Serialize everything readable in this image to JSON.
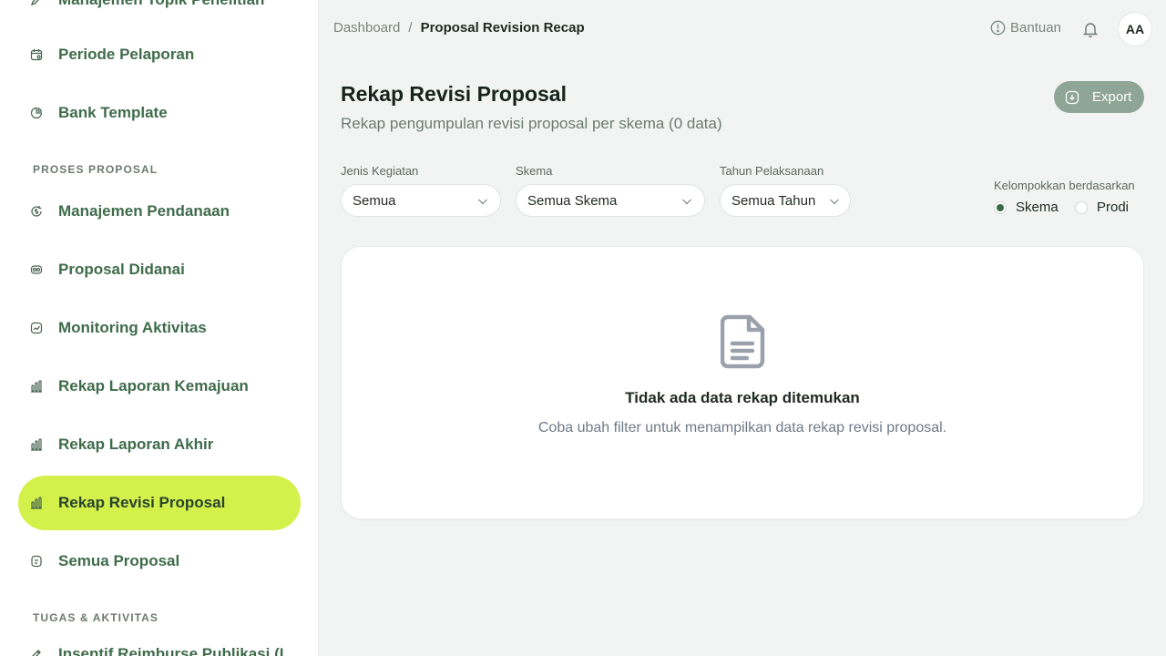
{
  "sidebar": {
    "items": [
      {
        "label": "Manajemen Topik Penelitian",
        "icon": "pen-icon"
      },
      {
        "label": "Periode Pelaporan",
        "icon": "calendar-icon"
      },
      {
        "label": "Bank Template",
        "icon": "pie-icon"
      },
      {
        "label": "Manajemen Pendanaan",
        "icon": "dollar-cycle-icon"
      },
      {
        "label": "Proposal Didanai",
        "icon": "money-icon"
      },
      {
        "label": "Monitoring Aktivitas",
        "icon": "activity-icon"
      },
      {
        "label": "Rekap Laporan Kemajuan",
        "icon": "bar-chart-icon"
      },
      {
        "label": "Rekap Laporan Akhir",
        "icon": "bar-chart-icon"
      },
      {
        "label": "Rekap Revisi Proposal",
        "icon": "bar-chart-icon",
        "active": true
      },
      {
        "label": "Semua Proposal",
        "icon": "document-icon"
      },
      {
        "label": "Insentif Reimburse Publikasi (L",
        "icon": "pen-icon"
      }
    ],
    "sections": [
      "PROSES PROPOSAL",
      "TUGAS & AKTIVITAS"
    ]
  },
  "topbar": {
    "breadcrumb": [
      "Dashboard",
      "/",
      "Proposal Revision Recap"
    ],
    "help_label": "Bantuan",
    "avatar_initials": "AA"
  },
  "header": {
    "title": "Rekap Revisi Proposal",
    "subtitle": "Rekap pengumpulan revisi proposal per skema (0 data)",
    "export_label": "Export"
  },
  "filters": {
    "jenis": {
      "label": "Jenis Kegiatan",
      "value": "Semua"
    },
    "skema": {
      "label": "Skema",
      "value": "Semua Skema"
    },
    "tahun": {
      "label": "Tahun Pelaksanaan",
      "value": "Semua Tahun"
    },
    "group": {
      "label": "Kelompokkan berdasarkan",
      "options": [
        "Skema",
        "Prodi"
      ],
      "selected": "Skema"
    }
  },
  "empty": {
    "title": "Tidak ada data rekap ditemukan",
    "description": "Coba ubah filter untuk menampilkan data rekap revisi proposal."
  },
  "colors": {
    "accent": "#d4f04b",
    "primary": "#3f6b4b",
    "export_bg": "#8fa596"
  }
}
